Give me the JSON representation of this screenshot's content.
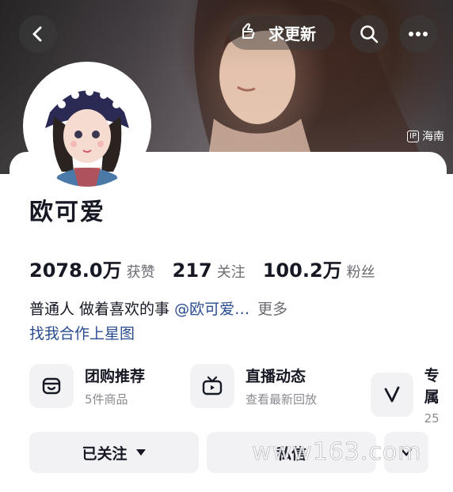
{
  "header": {
    "back_icon": "chevron-left-icon",
    "request_update_label": "求更新",
    "search_icon": "search-icon",
    "more_icon": "ellipsis-icon",
    "ip_badge": "IP",
    "ip_location": "海南"
  },
  "profile": {
    "name": "欧可爱",
    "stats": [
      {
        "value": "2078.0万",
        "label": "获赞"
      },
      {
        "value": "217",
        "label": "关注"
      },
      {
        "value": "100.2万",
        "label": "粉丝"
      }
    ],
    "bio_text": "普通人 做着喜欢的事 ",
    "bio_mention": "@欧可爱…",
    "bio_more": "更多",
    "link_text": "找我合作上星图"
  },
  "features": [
    {
      "title": "团购推荐",
      "subtitle": "5件商品",
      "icon": "shop-bag-icon"
    },
    {
      "title": "直播动态",
      "subtitle": "查看最新回放",
      "icon": "tv-icon"
    },
    {
      "title": "专属",
      "subtitle": "25",
      "icon": "v-icon"
    }
  ],
  "actions": {
    "follow_label": "已关注",
    "message_label": "私信"
  },
  "watermark": "www163.com"
}
